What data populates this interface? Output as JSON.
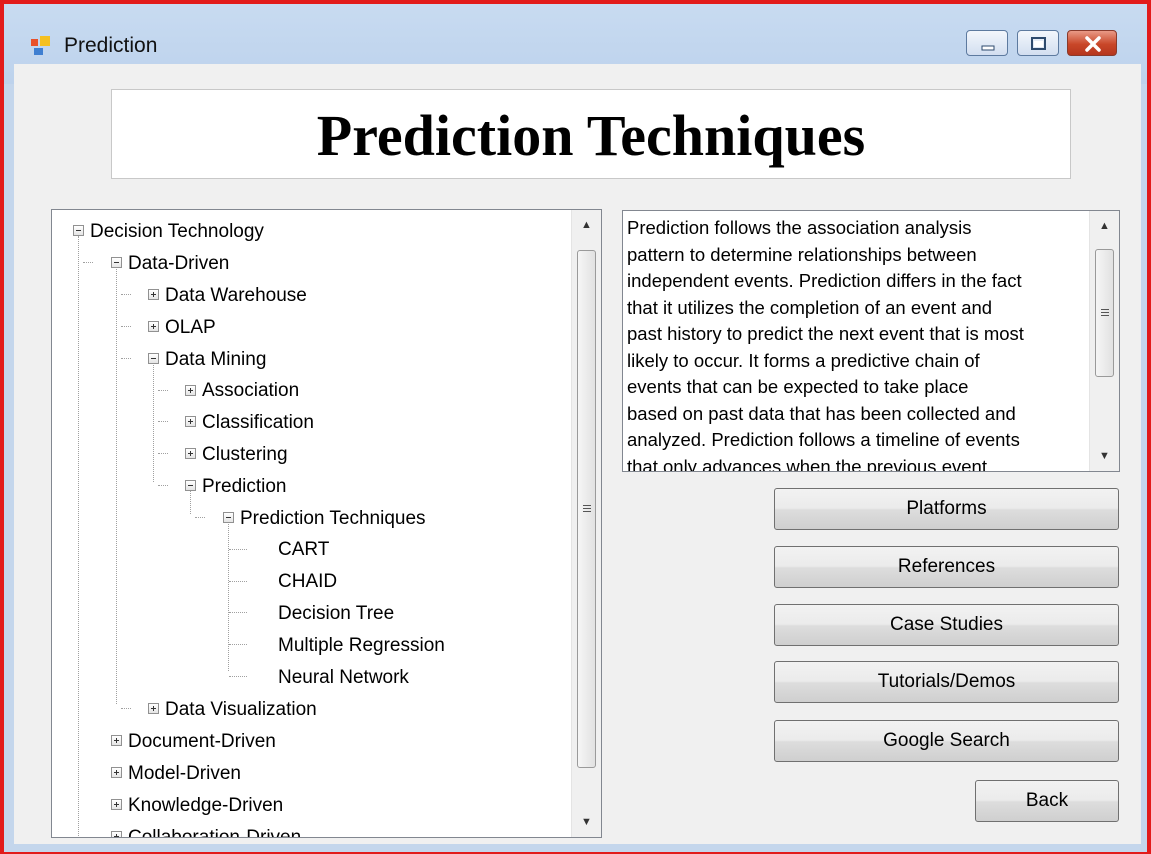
{
  "window": {
    "title": "Prediction"
  },
  "header": {
    "title": "Prediction Techniques"
  },
  "tree": {
    "root": "Decision Technology",
    "data_driven": "Data-Driven",
    "data_warehouse": "Data Warehouse",
    "olap": "OLAP",
    "data_mining": "Data Mining",
    "association": "Association",
    "classification": "Classification",
    "clustering": "Clustering",
    "prediction": "Prediction",
    "prediction_techniques": "Prediction Techniques",
    "techniques": [
      "CART",
      "CHAID",
      "Decision Tree",
      "Multiple Regression",
      "Neural Network"
    ],
    "data_visualization": "Data Visualization",
    "document_driven": "Document-Driven",
    "model_driven": "Model-Driven",
    "knowledge_driven": "Knowledge-Driven",
    "collaboration_driven": "Collaboration-Driven"
  },
  "description": {
    "lines": [
      "Prediction follows the association analysis",
      "pattern to determine relationships between",
      "independent events. Prediction differs in the fact",
      "that it utilizes the completion of an event and",
      "past history to predict the next event that is most",
      "likely to occur. It forms a predictive chain of",
      "events that can be expected to take place",
      "based on past data that has been collected and",
      "analyzed. Prediction follows a timeline of events",
      "that only advances when the previous event"
    ]
  },
  "buttons": {
    "platforms": "Platforms",
    "references": "References",
    "case_studies": "Case Studies",
    "tutorials": "Tutorials/Demos",
    "google": "Google Search",
    "back": "Back"
  },
  "icons": {
    "app": "app-form-icon",
    "minimize": "minimize-icon",
    "maximize": "maximize-icon",
    "close": "close-icon"
  },
  "colors": {
    "window_border": "#e21b1b",
    "titlebar": "#c4d6ec",
    "client": "#f0f0f0"
  }
}
